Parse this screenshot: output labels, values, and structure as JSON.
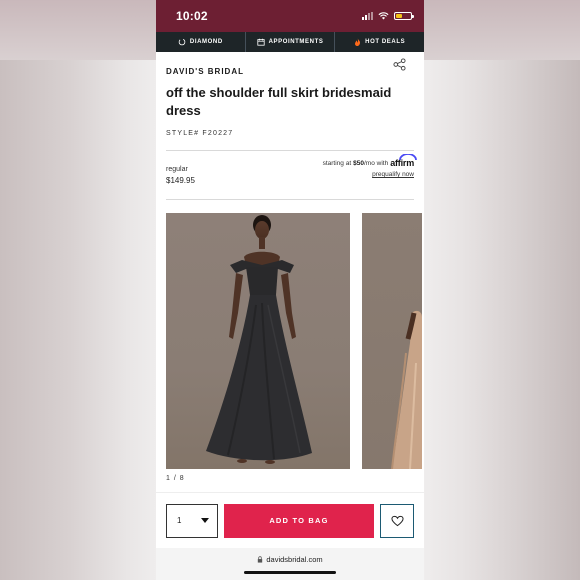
{
  "status_bar": {
    "time": "10:02"
  },
  "promo_bar": {
    "items": [
      {
        "label": "DIAMOND",
        "icon": "diamond-icon"
      },
      {
        "label": "APPOINTMENTS",
        "icon": "calendar-icon"
      },
      {
        "label": "HOT DEALS",
        "icon": "fire-icon"
      }
    ]
  },
  "product": {
    "brand": "DAVID'S BRIDAL",
    "title": "off the shoulder full skirt bridesmaid dress",
    "style": "STYLE# F20227",
    "price_label": "regular",
    "price": "$149.95",
    "financing_prefix": "starting at",
    "financing_amount": "$50",
    "financing_suffix": "/mo with",
    "financing_brand": "affirm",
    "prequalify": "prequalify now",
    "image_counter": "1 / 8"
  },
  "purchase": {
    "quantity": "1",
    "add_to_bag": "ADD TO BAG"
  },
  "browser": {
    "url": "davidsbridal.com"
  },
  "colors": {
    "status_bar": "#6d1f33",
    "promo_bar": "#1e2528",
    "add_button": "#e0234c"
  }
}
